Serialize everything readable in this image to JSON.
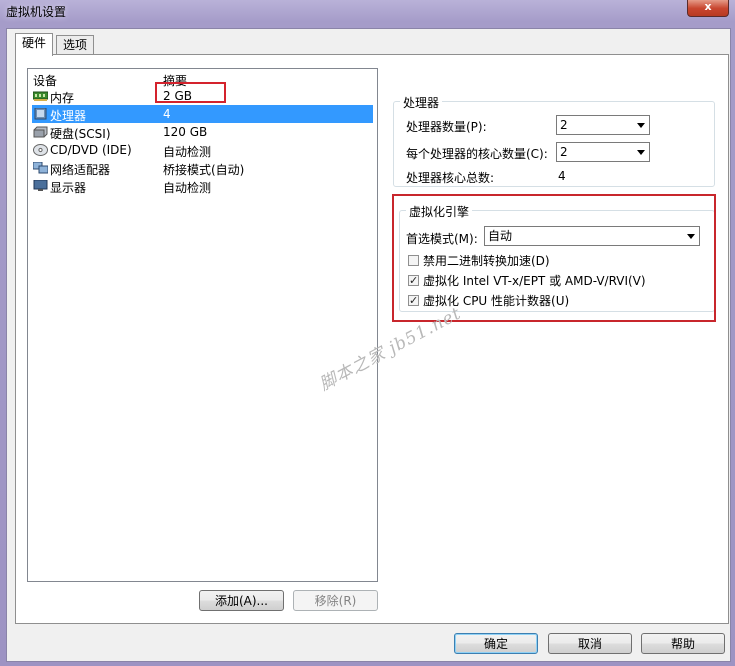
{
  "window": {
    "title": "虚拟机设置",
    "close_label": "x"
  },
  "tabs": [
    {
      "label": "硬件",
      "active": true
    },
    {
      "label": "选项",
      "active": false
    }
  ],
  "device_list": {
    "headers": {
      "device": "设备",
      "summary": "摘要"
    },
    "rows": [
      {
        "icon": "memory-icon",
        "name": "内存",
        "summary": "2 GB",
        "selected": false
      },
      {
        "icon": "processor-icon",
        "name": "处理器",
        "summary": "4",
        "selected": true
      },
      {
        "icon": "hard-disk-icon",
        "name": "硬盘(SCSI)",
        "summary": "120 GB",
        "selected": false
      },
      {
        "icon": "cd-dvd-icon",
        "name": "CD/DVD (IDE)",
        "summary": "自动检测",
        "selected": false
      },
      {
        "icon": "network-adapter-icon",
        "name": "网络适配器",
        "summary": "桥接模式(自动)",
        "selected": false
      },
      {
        "icon": "display-icon",
        "name": "显示器",
        "summary": "自动检测",
        "selected": false
      }
    ]
  },
  "list_buttons": {
    "add": "添加(A)...",
    "remove": "移除(R)"
  },
  "processor": {
    "group_title": "处理器",
    "count_label": "处理器数量(P):",
    "count_value": "2",
    "cores_label": "每个处理器的核心数量(C):",
    "cores_value": "2",
    "total_label": "处理器核心总数:",
    "total_value": "4"
  },
  "virtualization": {
    "group_title": "虚拟化引擎",
    "mode_label": "首选模式(M):",
    "mode_value": "自动",
    "options": [
      {
        "label": "禁用二进制转换加速(D)",
        "checked": false
      },
      {
        "label": "虚拟化 Intel VT-x/EPT 或 AMD-V/RVI(V)",
        "checked": true
      },
      {
        "label": "虚拟化 CPU 性能计数器(U)",
        "checked": true
      }
    ]
  },
  "watermark": "脚本之家 jb51.net",
  "dialog_buttons": {
    "ok": "确定",
    "cancel": "取消",
    "help": "帮助"
  },
  "colors": {
    "selection": "#3399ff",
    "annotation_red": "#c8262c",
    "title_bar": "#a59cc9"
  }
}
